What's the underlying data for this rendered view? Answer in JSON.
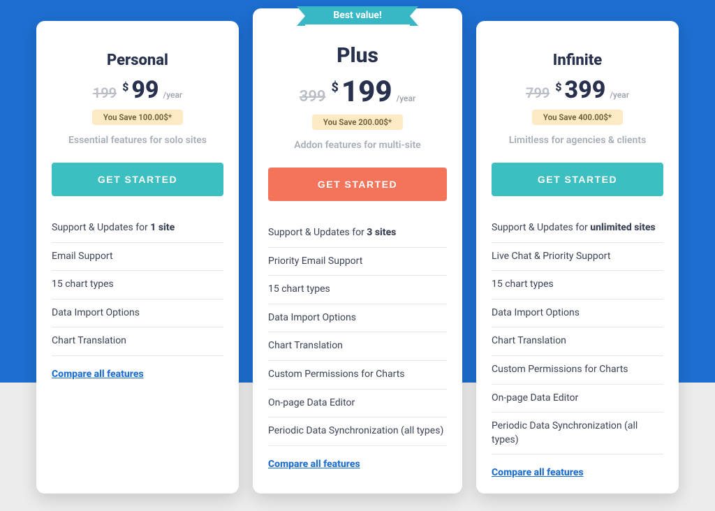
{
  "ribbon": "Best value!",
  "cta_label": "GET STARTED",
  "compare_label": "Compare all features",
  "plans": [
    {
      "name": "Personal",
      "old_price": "199",
      "currency": "$",
      "price": "99",
      "period": "/year",
      "save": "You Save 100.00$*",
      "tagline": "Essential features for solo sites",
      "features_prefix": "Support & Updates for ",
      "features_bold": "1 site",
      "features": [
        "Email Support",
        "15 chart types",
        "Data Import Options",
        "Chart Translation"
      ]
    },
    {
      "name": "Plus",
      "old_price": "399",
      "currency": "$",
      "price": "199",
      "period": "/year",
      "save": "You Save 200.00$*",
      "tagline": "Addon features for multi-site",
      "features_prefix": "Support & Updates for ",
      "features_bold": "3 sites",
      "features": [
        "Priority Email Support",
        "15 chart types",
        "Data Import Options",
        "Chart Translation",
        "Custom Permissions for Charts",
        "On-page Data Editor",
        "Periodic Data Synchronization (all types)"
      ]
    },
    {
      "name": "Infinite",
      "old_price": "799",
      "currency": "$",
      "price": "399",
      "period": "/year",
      "save": "You Save 400.00$*",
      "tagline": "Limitless for agencies & clients",
      "features_prefix": "Support & Updates for ",
      "features_bold": "unlimited sites",
      "features": [
        "Live Chat & Priority Support",
        "15 chart types",
        "Data Import Options",
        "Chart Translation",
        "Custom Permissions for Charts",
        "On-page Data Editor",
        "Periodic Data Synchronization (all types)"
      ]
    }
  ]
}
